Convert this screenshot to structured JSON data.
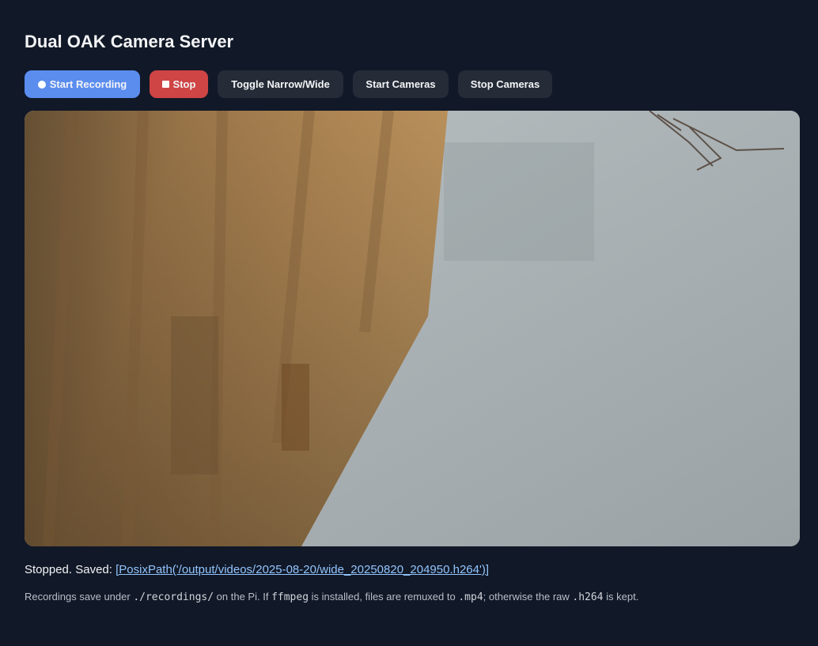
{
  "page_title": "Dual OAK Camera Server",
  "toolbar": {
    "start_recording_label": "Start Recording",
    "stop_label": "Stop",
    "toggle_label": "Toggle Narrow/Wide",
    "start_cameras_label": "Start Cameras",
    "stop_cameras_label": "Stop Cameras"
  },
  "icons": {
    "record": "record-dot-icon",
    "stop": "stop-square-icon"
  },
  "colors": {
    "background": "#111827",
    "record_button": "#5b8def",
    "stop_button": "#cf4444",
    "dark_button": "#252c38",
    "link": "#93c5fd"
  },
  "status": {
    "prefix": "Stopped. Saved: ",
    "link_text": "[PosixPath('/output/videos/2025-08-20/wide_20250820_204950.h264')]"
  },
  "note": {
    "t1": "Recordings save under ",
    "c1": "./recordings/",
    "t2": " on the Pi. If ",
    "c2": "ffmpeg",
    "t3": " is installed, files are remuxed to ",
    "c3": ".mp4",
    "t4": "; otherwise the raw ",
    "c4": ".h264",
    "t5": " is kept."
  }
}
